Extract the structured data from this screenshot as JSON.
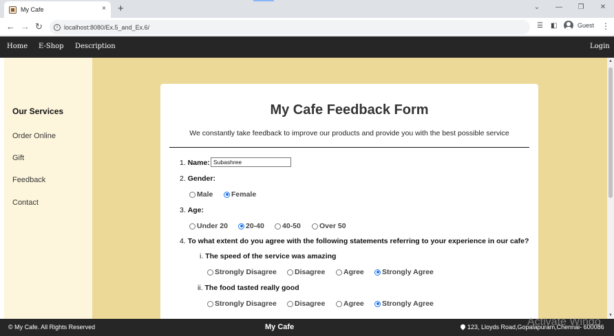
{
  "browser": {
    "tab_title": "My Cafe",
    "tab_close": "×",
    "new_tab": "+",
    "url": "localhost:8080/Ex.5_and_Ex.6/",
    "profile_name": "Guest",
    "icons": [
      "back-icon",
      "forward-icon",
      "reload-icon",
      "info-icon",
      "reading-list-icon",
      "side-panel-icon",
      "avatar-icon",
      "menu-icon",
      "minimize-icon",
      "restore-icon",
      "close-icon"
    ]
  },
  "nav": {
    "home": "Home",
    "eshop": "E-Shop",
    "description": "Description",
    "login": "Login"
  },
  "sidebar": {
    "title": "Our Services",
    "items": [
      {
        "label": "Order Online"
      },
      {
        "label": "Gift"
      },
      {
        "label": "Feedback"
      },
      {
        "label": "Contact"
      }
    ]
  },
  "form": {
    "title": "My Cafe Feedback Form",
    "subtitle": "We constantly take feedback to improve our products and provide you with the best possible service",
    "q1": {
      "num": "1.",
      "label": "Name:",
      "value": "Subashree"
    },
    "q2": {
      "num": "2.",
      "label": "Gender:",
      "options": [
        "Male",
        "Female"
      ],
      "selected": "Female"
    },
    "q3": {
      "num": "3.",
      "label": "Age:",
      "options": [
        "Under 20",
        "20-40",
        "40-50",
        "Over 50"
      ],
      "selected": "20-40"
    },
    "q4": {
      "num": "4.",
      "label": "To what extent do you agree with the following statements referring to your experience in our cafe?",
      "options": [
        "Strongly Disagree",
        "Disagree",
        "Agree",
        "Strongly Agree"
      ],
      "sub": [
        {
          "num": "i.",
          "label": "The speed of the service was amazing",
          "selected": "Strongly Agree"
        },
        {
          "num": "ii.",
          "label": "The food tasted really good",
          "selected": "Strongly Agree"
        }
      ]
    }
  },
  "footer": {
    "left": "© My Cafe. All Rights Reserved",
    "center": "My Cafe",
    "right": "123, Lloyds Road,Gopalapuram,Chennai- 600086",
    "watermark": "Activate Windo"
  },
  "colors": {
    "nav_bg": "#262626",
    "sidebar_bg": "#fdf5dc",
    "main_bg": "#ecd998",
    "radio_selected": "#1a73e8"
  }
}
